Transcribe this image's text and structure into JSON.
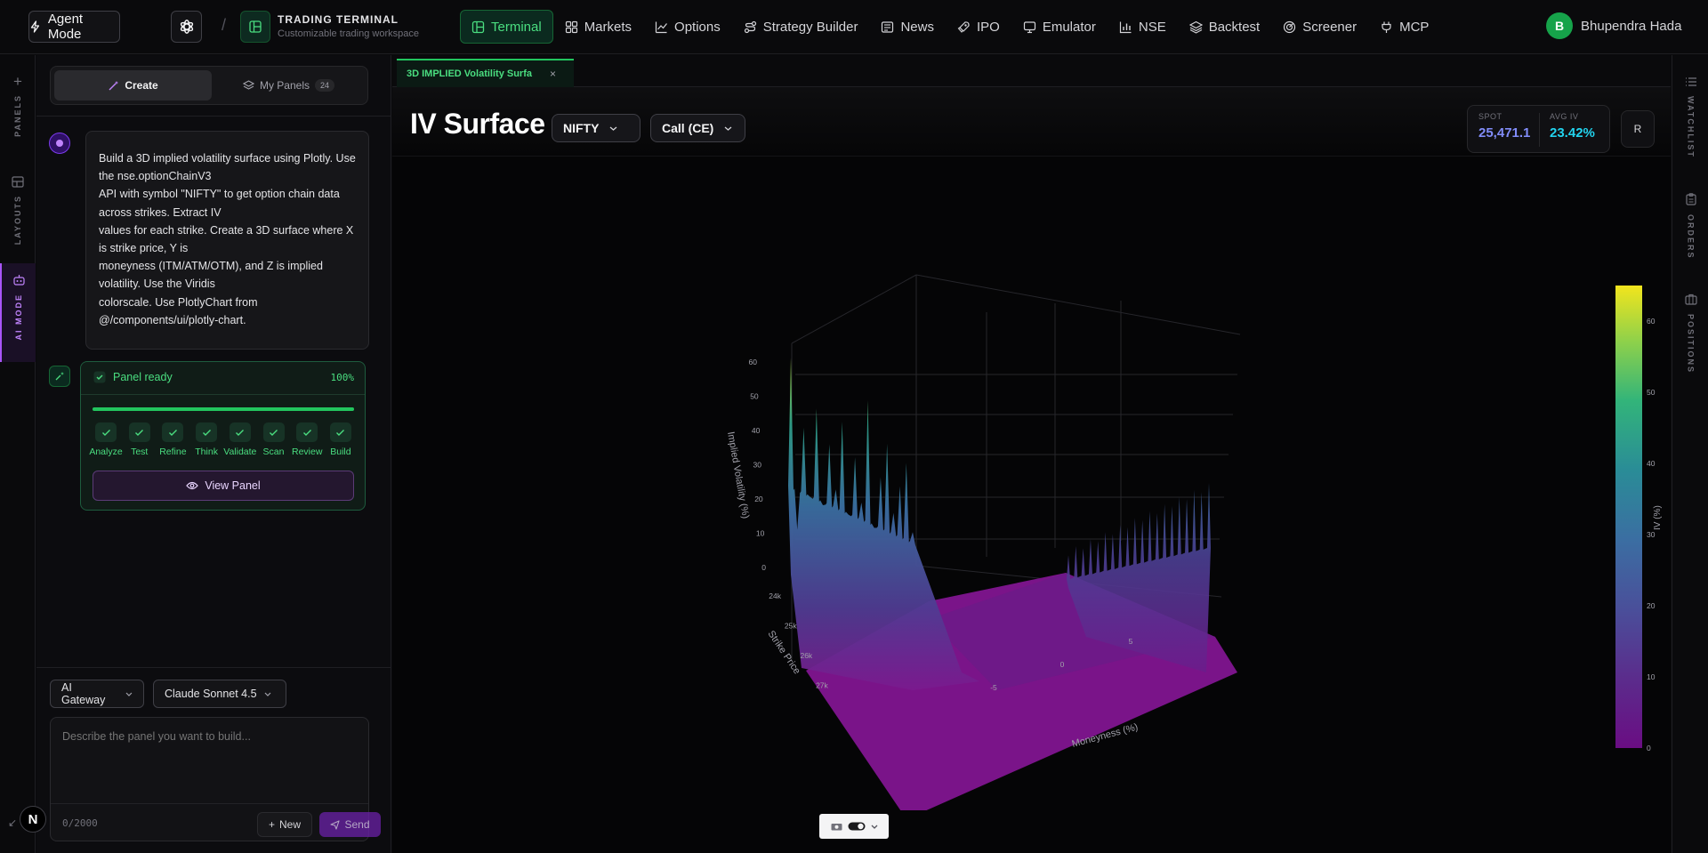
{
  "topbar": {
    "agent_mode": "Agent Mode",
    "brand_title": "TRADING TERMINAL",
    "brand_subtitle": "Customizable trading workspace",
    "nav": [
      {
        "label": "Terminal",
        "icon": "layout-icon",
        "active": true
      },
      {
        "label": "Markets",
        "icon": "grid-icon"
      },
      {
        "label": "Options",
        "icon": "trend-icon"
      },
      {
        "label": "Strategy Builder",
        "icon": "route-icon"
      },
      {
        "label": "News",
        "icon": "newspaper-icon"
      },
      {
        "label": "IPO",
        "icon": "rocket-icon"
      },
      {
        "label": "Emulator",
        "icon": "monitor-icon"
      },
      {
        "label": "NSE",
        "icon": "bar-chart-icon"
      },
      {
        "label": "Backtest",
        "icon": "layers-icon"
      },
      {
        "label": "Screener",
        "icon": "radar-icon"
      },
      {
        "label": "MCP",
        "icon": "plug-icon"
      }
    ],
    "user_initial": "B",
    "user_name": "Bhupendra Hada"
  },
  "left_rail": {
    "panels": "PANELS",
    "layouts": "LAYOUTS",
    "ai_mode": "AI MODE"
  },
  "chat": {
    "tab_create": "Create",
    "tab_my_panels": "My Panels",
    "my_panels_count": "24",
    "prompt_lines": [
      "Build a 3D implied volatility surface using Plotly. Use the nse.optionChainV3",
      "API with symbol \"NIFTY\" to get option chain data across strikes. Extract IV",
      "values for each strike. Create a 3D surface where X is strike price, Y is",
      "moneyness (ITM/ATM/OTM), and Z is implied volatility. Use the Viridis",
      "colorscale. Use PlotlyChart from @/components/ui/plotly-chart."
    ],
    "status_label": "Panel ready",
    "status_percent": "100%",
    "progress": 1.0,
    "steps": [
      "Analyze",
      "Test",
      "Refine",
      "Think",
      "Validate",
      "Scan",
      "Review",
      "Build"
    ],
    "view_panel": "View Panel",
    "gateway": "AI Gateway",
    "model": "Claude Sonnet 4.5",
    "composer_placeholder": "Describe the panel you want to build...",
    "char_count": "0/2000",
    "new_label": "New",
    "send_label": "Send",
    "n_badge": "N"
  },
  "main": {
    "tab_label": "3D IMPLIED Volatility Surfa",
    "tab_close": "×",
    "title": "IV Surface",
    "symbol": "NIFTY",
    "option_type": "Call (CE)",
    "spot_label": "SPOT",
    "spot_value": "25,471.1",
    "avg_iv_label": "AVG IV",
    "avg_iv_value": "23.42%",
    "r_button": "R",
    "colors": {
      "spot": "#818cf8",
      "avg_iv": "#22d3ee",
      "accent": "#22c55e"
    }
  },
  "chart_data": {
    "type": "surface",
    "colorscale": "Viridis",
    "z_axis": {
      "label": "Implied Volatility (%)",
      "ticks": [
        "0",
        "10",
        "20",
        "30",
        "40",
        "50",
        "60"
      ]
    },
    "x_axis": {
      "label": "Strike Price",
      "ticks": [
        "24k",
        "25k",
        "26k",
        "27k"
      ]
    },
    "y_axis": {
      "label": "Moneyness (%)",
      "ticks": [
        "-5",
        "0",
        "5"
      ]
    },
    "colorbar": {
      "label": "IV (%)",
      "ticks": [
        "0",
        "10",
        "20",
        "30",
        "40",
        "50",
        "60"
      ],
      "range": [
        0,
        65
      ]
    },
    "left_edge_iv_peaks": [
      62,
      12,
      42,
      22,
      48,
      20,
      38,
      25,
      45,
      18,
      35,
      22,
      52,
      15,
      30,
      40,
      20,
      28,
      35,
      15
    ],
    "right_edge_iv_peaks": [
      4,
      6,
      5,
      7,
      6,
      8,
      7,
      9,
      8,
      10,
      9,
      11,
      10,
      12,
      11,
      13,
      12,
      14,
      13,
      15
    ]
  },
  "right_rail": {
    "watchlist": "WATCHLIST",
    "orders": "ORDERS",
    "positions": "POSITIONS"
  }
}
